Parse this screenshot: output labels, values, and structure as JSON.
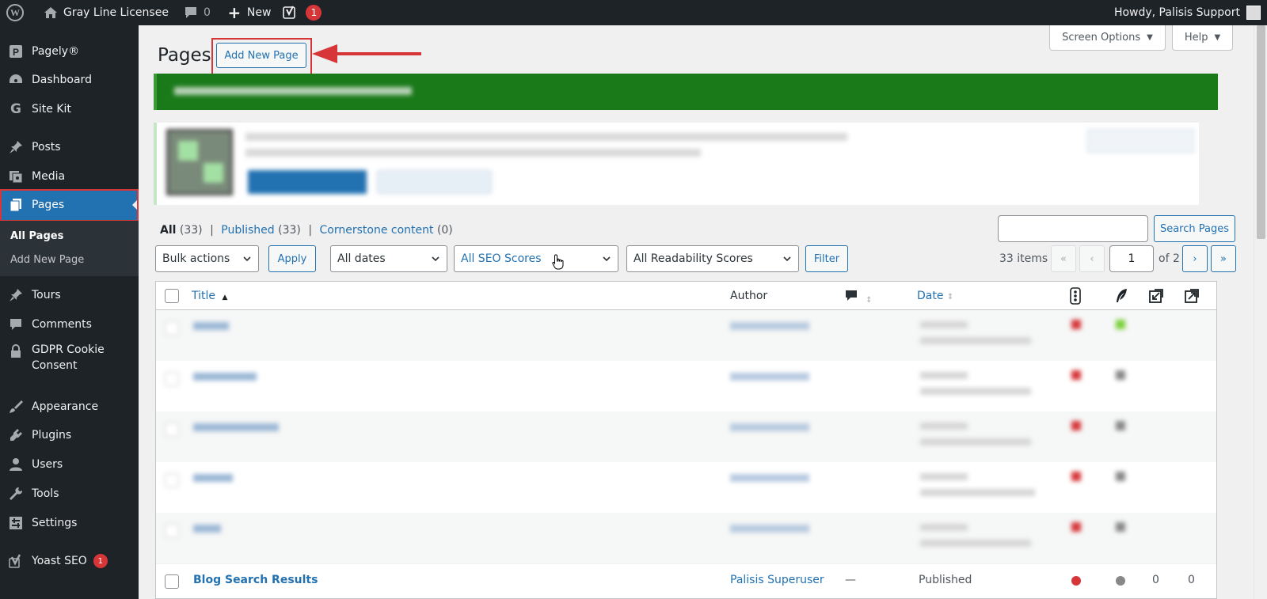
{
  "adminbar": {
    "site_name": "Gray Line Licensee",
    "comments_count": "0",
    "new_label": "New",
    "yoast_badge": "1",
    "howdy": "Howdy, Palisis Support"
  },
  "sidebar": {
    "items": [
      {
        "label": "Pagely®",
        "icon": "pagely-icon"
      },
      {
        "label": "Dashboard",
        "icon": "dashboard-icon"
      },
      {
        "label": "Site Kit",
        "icon": "google-g-icon"
      },
      {
        "label": "Posts",
        "icon": "pin-icon"
      },
      {
        "label": "Media",
        "icon": "media-icon"
      },
      {
        "label": "Pages",
        "icon": "pages-icon"
      },
      {
        "label": "Tours",
        "icon": "pin-icon"
      },
      {
        "label": "Comments",
        "icon": "comment-icon"
      },
      {
        "label": "GDPR Cookie",
        "label2": "Consent",
        "icon": "lock-icon"
      },
      {
        "label": "Appearance",
        "icon": "brush-icon"
      },
      {
        "label": "Plugins",
        "icon": "plugin-icon"
      },
      {
        "label": "Users",
        "icon": "user-icon"
      },
      {
        "label": "Tools",
        "icon": "wrench-icon"
      },
      {
        "label": "Settings",
        "icon": "settings-icon"
      },
      {
        "label": "Yoast SEO",
        "icon": "yoast-icon",
        "badge": "1"
      }
    ],
    "submenu": {
      "all_pages": "All Pages",
      "add_new_page": "Add New Page"
    }
  },
  "header": {
    "title": "Pages",
    "add_new": "Add New Page",
    "screen_options": "Screen Options",
    "help": "Help"
  },
  "filters": {
    "all": "All",
    "all_count": "(33)",
    "published": "Published",
    "published_count": "(33)",
    "cornerstone": "Cornerstone content",
    "cornerstone_count": "(0)",
    "search_button": "Search Pages",
    "bulk_actions": "Bulk actions",
    "apply": "Apply",
    "all_dates": "All dates",
    "seo_scores": "All SEO Scores",
    "readability": "All Readability Scores",
    "filter": "Filter",
    "items_count": "33 items",
    "first": "«",
    "prev": "‹",
    "current_page": "1",
    "of_pages": "of 2",
    "next": "›",
    "last": "»"
  },
  "table": {
    "col_title": "Title",
    "col_author": "Author",
    "col_date": "Date",
    "last_row": {
      "title": "Blog Search Results",
      "author": "Palisis Superuser",
      "comments": "—",
      "date_status": "Published",
      "links_in": "0",
      "links_out": "0"
    }
  },
  "colors": {
    "accent": "#2271b1",
    "sidebar_bg": "#1d2327",
    "notice_green": "#1a7a1a",
    "highlight_red": "#d63638"
  }
}
